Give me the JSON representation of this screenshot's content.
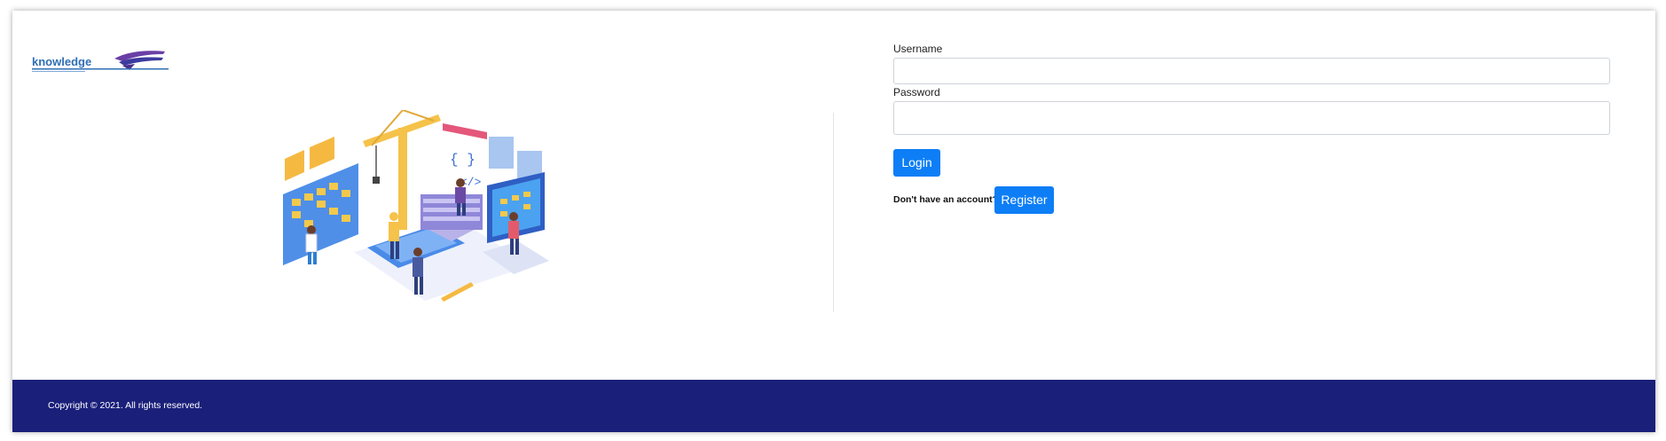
{
  "brand": {
    "logo_text": "knowledge"
  },
  "login": {
    "username_label": "Username",
    "username_value": "",
    "password_label": "Password",
    "password_value": "",
    "login_button": "Login",
    "register_prompt": "Don't have an account?",
    "register_button": "Register"
  },
  "illustration": {
    "icon": "isometric-software-development-illustration"
  },
  "footer": {
    "copyright": "Copyright © 2021. All rights reserved."
  },
  "colors": {
    "primary_button": "#0d7ef6",
    "footer_background": "#1a1f7a",
    "footer_text": "#ffffff"
  }
}
